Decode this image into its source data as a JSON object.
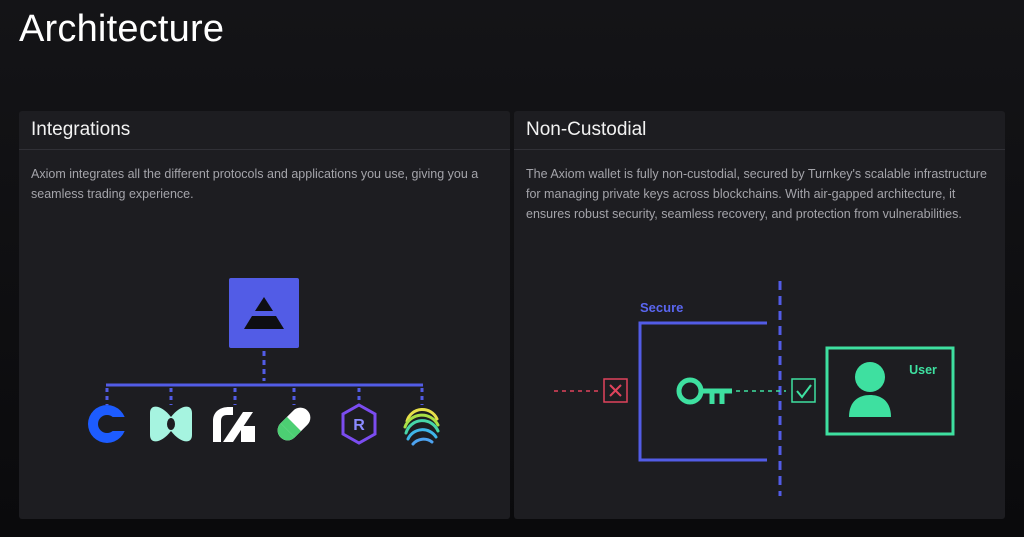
{
  "page": {
    "title": "Architecture"
  },
  "integrations": {
    "title": "Integrations",
    "description": "Axiom integrates all the different protocols and applications you use, giving you a seamless trading experience.",
    "hub_icon": "axiom-logo-icon",
    "logos": [
      "coinbase-icon",
      "hyperliquid-icon",
      "pump-swap-icon",
      "pill-icon",
      "raydium-icon",
      "meteora-icon"
    ]
  },
  "non_custodial": {
    "title": "Non-Custodial",
    "description": "The Axiom wallet is fully non-custodial, secured by Turnkey's scalable infrastructure for managing private keys across blockchains. With air-gapped architecture, it ensures robust security, seamless recovery, and protection from vulnerabilities.",
    "secure_label": "Secure",
    "user_label": "User",
    "colors": {
      "accent": "#4f5ae8",
      "green": "#3ee0a0",
      "red": "#e0435c"
    }
  }
}
